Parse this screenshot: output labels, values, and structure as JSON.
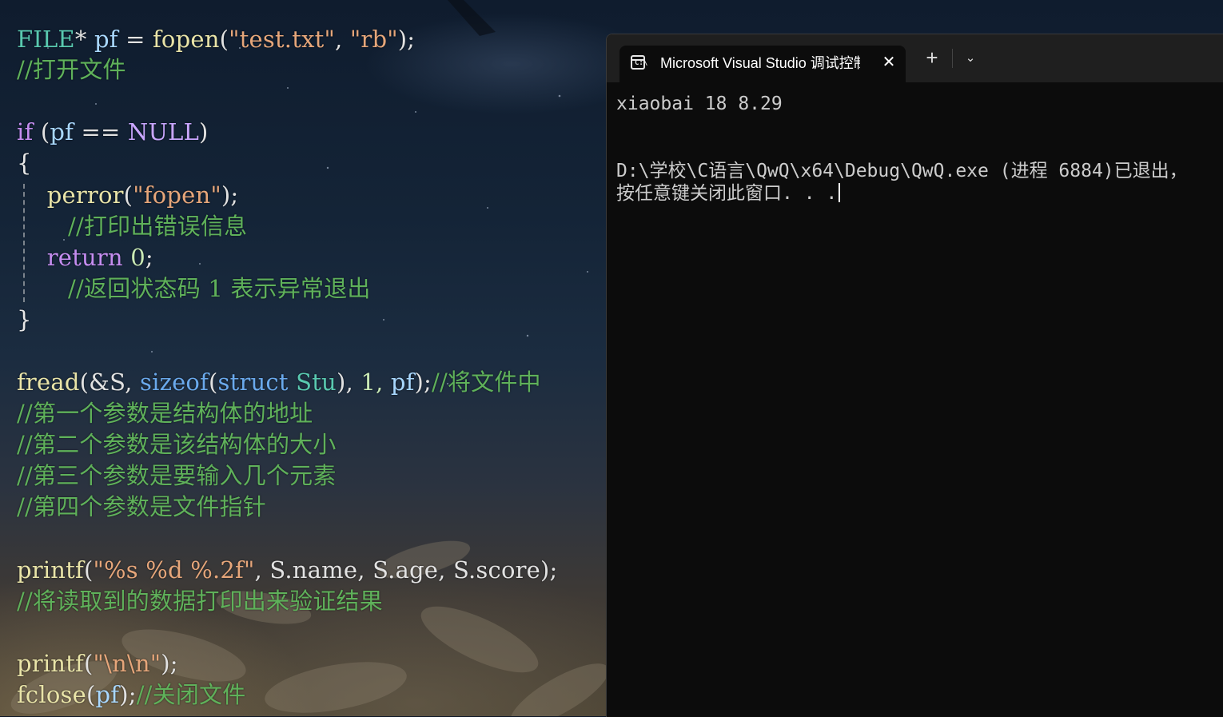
{
  "editor": {
    "code": {
      "line1": {
        "type": "FILE",
        "op": "*",
        "var": "pf",
        "eq": "=",
        "fn": "fopen",
        "args_open": "(",
        "str1": "\"test.txt\"",
        "comma": ",",
        "str2": "\"rb\"",
        "args_close": ");"
      },
      "line2": "//打开文件",
      "line3": {
        "kw": "if",
        "open": "(",
        "var": "pf",
        "op": "==",
        "mac": "NULL",
        "close": ")"
      },
      "line4": "{",
      "line5": {
        "fn": "perror",
        "open": "(",
        "str": "\"fopen\"",
        "close": ");"
      },
      "line6": "//打印出错误信息",
      "line7": {
        "kw": "return",
        "num": "0",
        "semi": ";"
      },
      "line8": "//返回状态码 1 表示异常退出",
      "line9": "}",
      "line10": {
        "fn": "fread",
        "p1": "(&S,",
        "kw": "sizeof",
        "p2": "(",
        "kw2": "struct",
        "type": "Stu",
        "p3": "),",
        "num": "1,",
        "var": "pf",
        "p4": ");",
        "cmt": "//将文件中"
      },
      "line11": "//第一个参数是结构体的地址",
      "line12": "//第二个参数是该结构体的大小",
      "line13": "//第三个参数是要输入几个元素",
      "line14": "//第四个参数是文件指针",
      "line15": {
        "fn": "printf",
        "open": "(",
        "str": "\"%s %d %.2f\"",
        "rest": ", S.name, S.age, S.score);"
      },
      "line16": "//将读取到的数据打印出来验证结果",
      "line17": {
        "fn": "printf",
        "open": "(",
        "str": "\"\\n\\n\"",
        "close": ");"
      },
      "line18": {
        "fn": "fclose",
        "open": "(",
        "var": "pf",
        "close": ");",
        "cmt": "//关闭文件"
      }
    }
  },
  "terminal": {
    "tab_title": "Microsoft Visual Studio 调试控制台",
    "tab_icon_text": "C:\\",
    "close_glyph": "✕",
    "new_tab_glyph": "+",
    "dropdown_glyph": "⌄",
    "output": [
      "xiaobai 18 8.29",
      "",
      "",
      "D:\\学校\\C语言\\QwQ\\x64\\Debug\\QwQ.exe (进程 6884)已退出，",
      "按任意键关闭此窗口. . ."
    ]
  }
}
